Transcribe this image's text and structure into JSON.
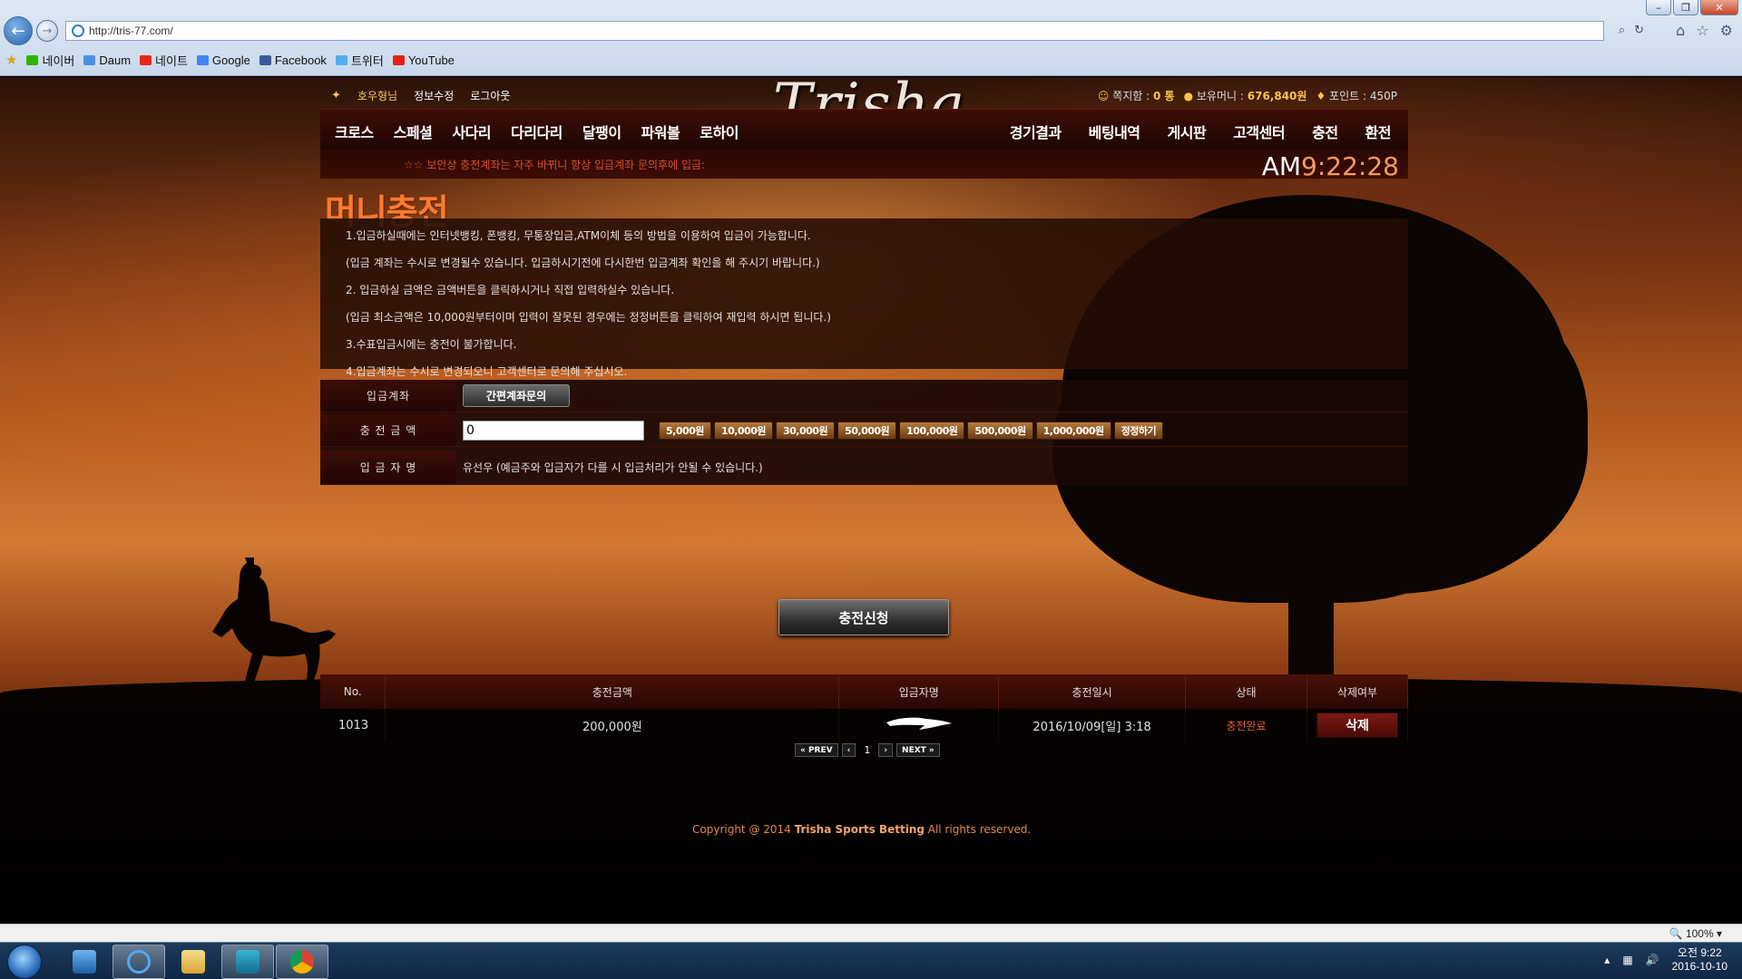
{
  "browser": {
    "url": "http://tris-77.com/",
    "zoom": "100%",
    "favorites": [
      {
        "label": "네이버",
        "color": "#2db400"
      },
      {
        "label": "Daum",
        "color": "#4a90e2"
      },
      {
        "label": "네이트",
        "color": "#e8281a"
      },
      {
        "label": "Google",
        "color": "#4285f4"
      },
      {
        "label": "Facebook",
        "color": "#3b5998"
      },
      {
        "label": "트위터",
        "color": "#55acee"
      },
      {
        "label": "YouTube",
        "color": "#e62117"
      }
    ]
  },
  "header": {
    "user_name": "호우형님",
    "edit_info": "정보수정",
    "logout": "로그아웃",
    "logo": "Trisha",
    "messages_label": "쪽지함 :",
    "messages_value": "0 통",
    "money_label": "보유머니 :",
    "money_value": "676,840원",
    "points_label": "포인트 :",
    "points_value": "450P"
  },
  "nav": {
    "left": [
      "크로스",
      "스페셜",
      "사다리",
      "다리다리",
      "달팽이",
      "파워볼",
      "로하이"
    ],
    "right": [
      "경기결과",
      "베팅내역",
      "게시판",
      "고객센터",
      "충전",
      "환전"
    ]
  },
  "notice": "☆☆ 보안상 충전계좌는 자주 바뀌니 항상 입금계좌 문의후에 입금:",
  "clock": {
    "ampm": "AM",
    "time": "9:22:28"
  },
  "title": "머니충전",
  "info_lines": [
    "1.입금하실때에는 인터넷뱅킹, 폰뱅킹, 무통장입금,ATM이체 등의 방법을 이용하여 입금이 가능합니다.",
    "(입금 계좌는 수시로 변경될수 있습니다. 입금하시기전에 다시한번 입금계좌 확인을 해 주시기 바랍니다.)",
    "2. 입금하실 금액은 금액버튼을 클릭하시거나 직접 입력하실수 있습니다.",
    "(입금 최소금액은 10,000원부터이며 입력이 잘못된 경우에는 정정버튼을 클릭하여 재입력 하시면 됩니다.)",
    "3.수표입금시에는 충전이 불가합니다.",
    "4.입금계좌는 수시로 변경되오니 고객센터로 문의해 주십시오."
  ],
  "form": {
    "account_label": "입금계좌",
    "account_button": "간편계좌문의",
    "amount_label": "충 전 금 액",
    "amount_value": "0",
    "amount_buttons": [
      "5,000원",
      "10,000원",
      "30,000원",
      "50,000원",
      "100,000원",
      "500,000원",
      "1,000,000원",
      "정정하기"
    ],
    "depositor_label": "입 금 자 명",
    "depositor_value": "유선우  (예금주와 입금자가 다를 시 입금처리가 안될 수 있습니다.)",
    "submit": "충전신청"
  },
  "history": {
    "headers": [
      "No.",
      "충전금액",
      "입금자명",
      "충전일시",
      "상태",
      "삭제여부"
    ],
    "rows": [
      {
        "no": "1013",
        "amount": "200,000원",
        "datetime": "2016/10/09[일] 3:18",
        "status": "충전완료",
        "delete": "삭제"
      }
    ]
  },
  "pagination": {
    "prev": "PREV",
    "page": "1",
    "next": "NEXT"
  },
  "footer": {
    "prefix": "Copyright @ 2014 ",
    "brand": "Trisha Sports Betting",
    "suffix": " All rights reserved."
  },
  "taskbar": {
    "time": "오전 9:22",
    "date": "2016-10-10"
  }
}
